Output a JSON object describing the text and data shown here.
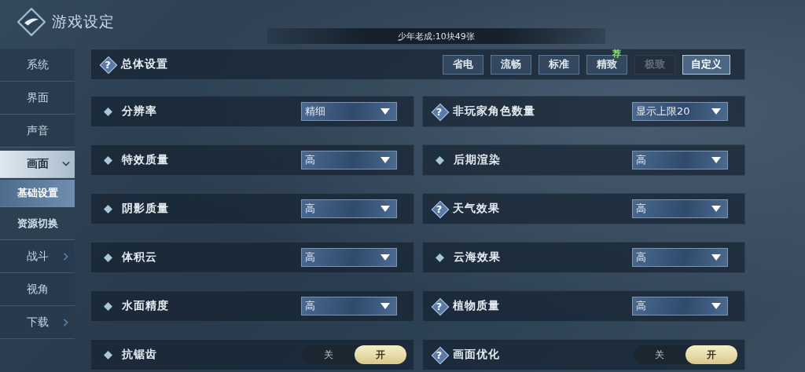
{
  "header": {
    "title": "游戏设定",
    "notice": "少年老成:10块49张"
  },
  "sidebar": {
    "items": [
      {
        "label": "系统",
        "selected": false
      },
      {
        "label": "界面",
        "selected": false
      },
      {
        "label": "声音",
        "selected": false
      },
      {
        "label": "画面",
        "selected": true,
        "expanded": true,
        "children": [
          {
            "label": "基础设置",
            "selected": true
          },
          {
            "label": "资源切换",
            "selected": false
          }
        ]
      },
      {
        "label": "战斗",
        "selected": false,
        "expanded": false
      },
      {
        "label": "视角",
        "selected": false
      },
      {
        "label": "下载",
        "selected": false,
        "expanded": false
      }
    ]
  },
  "overall": {
    "label": "总体设置",
    "help": "?",
    "presets": [
      {
        "label": "省电",
        "selected": false,
        "disabled": false
      },
      {
        "label": "流畅",
        "selected": false,
        "disabled": false
      },
      {
        "label": "标准",
        "selected": false,
        "disabled": false
      },
      {
        "label": "精致",
        "selected": false,
        "disabled": false,
        "badge": "荐"
      },
      {
        "label": "极致",
        "selected": false,
        "disabled": true
      },
      {
        "label": "自定义",
        "selected": true,
        "disabled": false
      }
    ]
  },
  "settings": [
    {
      "label": "分辨率",
      "kind": "dropdown",
      "value": "精细"
    },
    {
      "label": "非玩家角色数量",
      "help": "?",
      "kind": "dropdown",
      "value": "显示上限20"
    },
    {
      "label": "特效质量",
      "kind": "dropdown",
      "value": "高"
    },
    {
      "label": "后期渲染",
      "kind": "dropdown",
      "value": "高"
    },
    {
      "label": "阴影质量",
      "kind": "dropdown",
      "value": "高"
    },
    {
      "label": "天气效果",
      "help": "?",
      "kind": "dropdown",
      "value": "高"
    },
    {
      "label": "体积云",
      "kind": "dropdown",
      "value": "高"
    },
    {
      "label": "云海效果",
      "kind": "dropdown",
      "value": "高"
    },
    {
      "label": "水面精度",
      "kind": "dropdown",
      "value": "高"
    },
    {
      "label": "植物质量",
      "help": "?",
      "kind": "dropdown",
      "value": "高"
    },
    {
      "label": "抗锯齿",
      "kind": "toggle",
      "options": [
        {
          "label": "关",
          "selected": false
        },
        {
          "label": "开",
          "selected": true
        }
      ]
    },
    {
      "label": "画面优化",
      "help": "?",
      "kind": "toggle",
      "options": [
        {
          "label": "关",
          "selected": false
        },
        {
          "label": "开",
          "selected": true
        }
      ]
    }
  ]
}
